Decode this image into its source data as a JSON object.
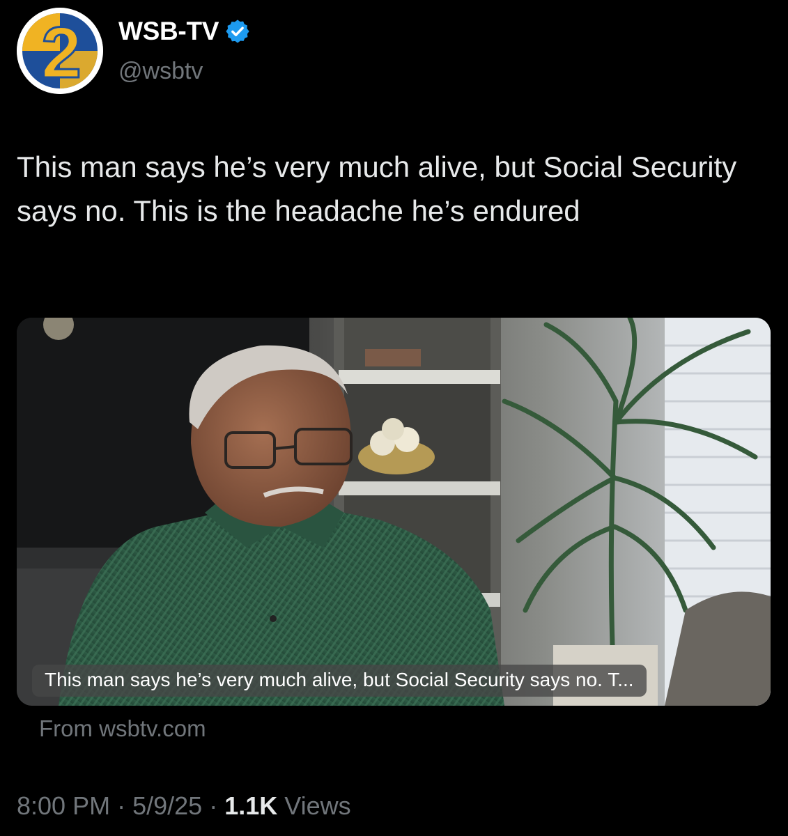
{
  "account": {
    "display_name": "WSB-TV",
    "handle": "@wsbtv",
    "verified_icon": "verified-badge-icon",
    "avatar_logo": "2"
  },
  "tweet": {
    "text": "This man says he’s very much alive, but Social Security says no. This is the headache he’s endured"
  },
  "media": {
    "caption": "This man says he’s very much alive, but Social Security says no. T...",
    "source": "From wsbtv.com"
  },
  "meta": {
    "time": "8:00 PM",
    "separator": "·",
    "date": "5/9/25",
    "views_count": "1.1K",
    "views_label": "Views"
  },
  "colors": {
    "background": "#000000",
    "text_primary": "#e7e9ea",
    "text_secondary": "#71767b",
    "verified": "#1d9bf0",
    "logo_blue": "#1e4f9a",
    "logo_gold": "#f0b323"
  }
}
